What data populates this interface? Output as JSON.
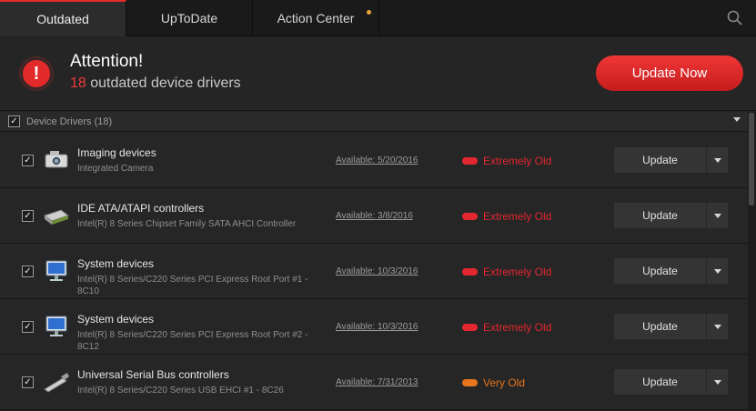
{
  "tabs": [
    {
      "label": "Outdated",
      "active": true
    },
    {
      "label": "UpToDate",
      "active": false
    },
    {
      "label": "Action Center",
      "active": false
    }
  ],
  "banner": {
    "title": "Attention!",
    "count": "18",
    "subtitle": "outdated device drivers",
    "update_now_label": "Update Now",
    "alert_glyph": "!"
  },
  "section": {
    "label": "Device Drivers (18)",
    "check": "✓"
  },
  "rows": [
    {
      "name": "Imaging devices",
      "desc": "Integrated Camera",
      "available": "Available: 5/20/2016",
      "status": "Extremely Old",
      "status_color": "#e3272f",
      "update_label": "Update",
      "icon": "camera-icon",
      "check": "✓"
    },
    {
      "name": "IDE ATA/ATAPI controllers",
      "desc": "Intel(R) 8 Series Chipset Family SATA AHCI Controller",
      "available": "Available: 3/8/2016",
      "status": "Extremely Old",
      "status_color": "#e3272f",
      "update_label": "Update",
      "icon": "drive-controller-icon",
      "check": "✓"
    },
    {
      "name": "System devices",
      "desc": "Intel(R) 8 Series/C220 Series PCI Express Root Port #1 - 8C10",
      "available": "Available: 10/3/2016",
      "status": "Extremely Old",
      "status_color": "#e3272f",
      "update_label": "Update",
      "icon": "computer-monitor-icon",
      "check": "✓"
    },
    {
      "name": "System devices",
      "desc": "Intel(R) 8 Series/C220 Series PCI Express Root Port #2 - 8C12",
      "available": "Available: 10/3/2016",
      "status": "Extremely Old",
      "status_color": "#e3272f",
      "update_label": "Update",
      "icon": "computer-monitor-icon",
      "check": "✓"
    },
    {
      "name": "Universal Serial Bus controllers",
      "desc": "Intel(R) 8 Series/C220 Series USB EHCI #1 - 8C26",
      "available": "Available: 7/31/2013",
      "status": "Very Old",
      "status_color": "#e8741c",
      "update_label": "Update",
      "icon": "usb-plug-icon",
      "check": "✓"
    }
  ],
  "colors": {
    "accent": "#e52a2a",
    "notification": "#e8a33a",
    "extremely_old": "#e3272f",
    "very_old": "#e8741c"
  }
}
